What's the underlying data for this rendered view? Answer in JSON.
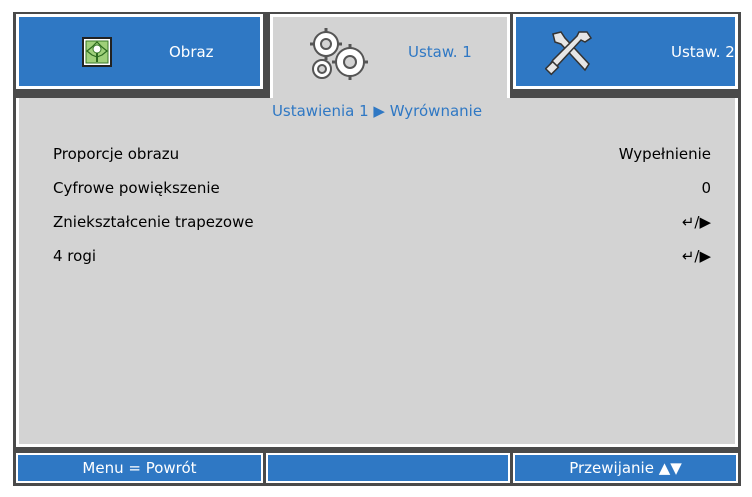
{
  "tabs": {
    "obraz": "Obraz",
    "ustaw1": "Ustaw. 1",
    "ustaw2": "Ustaw. 2"
  },
  "breadcrumb": "Ustawienia 1 ▶ Wyrównanie",
  "rows": [
    {
      "label": "Proporcje obrazu",
      "value": "Wypełnienie"
    },
    {
      "label": "Cyfrowe powiększenie",
      "value": "0"
    },
    {
      "label": "Zniekształcenie trapezowe",
      "value": "↵/▶"
    },
    {
      "label": "4 rogi",
      "value": "↵/▶"
    }
  ],
  "footer": {
    "left": "Menu = Powrót",
    "middle": "",
    "right": "Przewijanie ▲▼"
  },
  "icons": {
    "obraz": "picture-icon",
    "ustaw1": "gears-icon",
    "ustaw2": "tools-icon"
  },
  "colors": {
    "accent": "#2f78c4",
    "panel": "#d3d3d3",
    "frame": "#4a4a4a"
  }
}
